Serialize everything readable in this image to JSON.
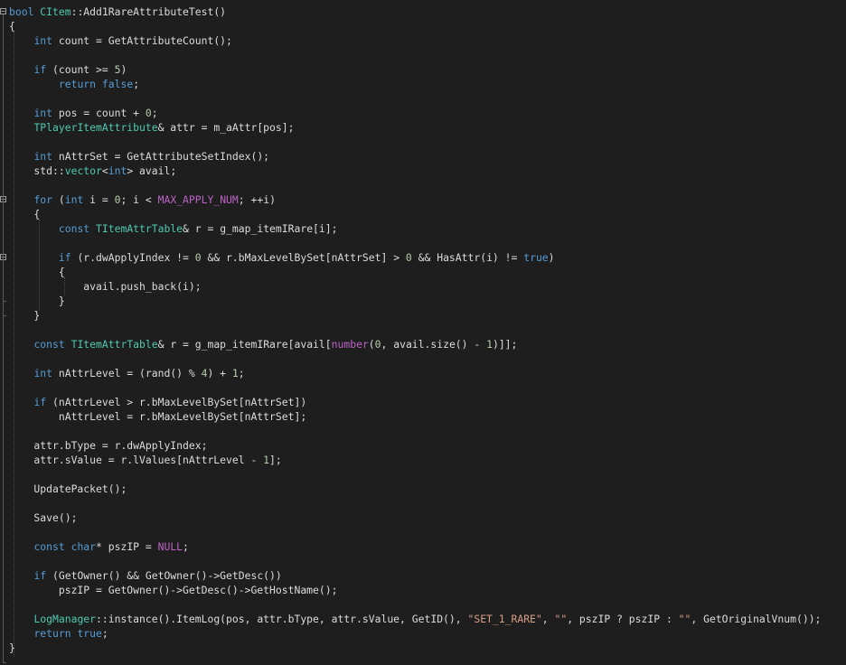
{
  "colors": {
    "background": "#1e1e1e",
    "plain": "#dcdcdc",
    "keyword": "#569cd6",
    "type": "#4ec9b0",
    "number": "#b5cea8",
    "string": "#d69d85",
    "macro": "#bd63c5"
  },
  "editor": {
    "lines": [
      {
        "tokens": [
          [
            "kw",
            "bool"
          ],
          [
            "pl",
            " "
          ],
          [
            "type",
            "CItem"
          ],
          [
            "pl",
            "::Add1RareAttributeTest()"
          ]
        ]
      },
      {
        "tokens": [
          [
            "pl",
            "{"
          ]
        ]
      },
      {
        "tokens": [
          [
            "pl",
            "    "
          ],
          [
            "kw",
            "int"
          ],
          [
            "pl",
            " count = GetAttributeCount();"
          ]
        ]
      },
      {
        "tokens": []
      },
      {
        "tokens": [
          [
            "pl",
            "    "
          ],
          [
            "kw",
            "if"
          ],
          [
            "pl",
            " (count >= "
          ],
          [
            "num",
            "5"
          ],
          [
            "pl",
            ")"
          ]
        ]
      },
      {
        "tokens": [
          [
            "pl",
            "        "
          ],
          [
            "kw",
            "return"
          ],
          [
            "pl",
            " "
          ],
          [
            "kw",
            "false"
          ],
          [
            "pl",
            ";"
          ]
        ]
      },
      {
        "tokens": []
      },
      {
        "tokens": [
          [
            "pl",
            "    "
          ],
          [
            "kw",
            "int"
          ],
          [
            "pl",
            " pos = count + "
          ],
          [
            "num",
            "0"
          ],
          [
            "pl",
            ";"
          ]
        ]
      },
      {
        "tokens": [
          [
            "pl",
            "    "
          ],
          [
            "type",
            "TPlayerItemAttribute"
          ],
          [
            "pl",
            "& attr = m_aAttr[pos];"
          ]
        ]
      },
      {
        "tokens": []
      },
      {
        "tokens": [
          [
            "pl",
            "    "
          ],
          [
            "kw",
            "int"
          ],
          [
            "pl",
            " nAttrSet = GetAttributeSetIndex();"
          ]
        ]
      },
      {
        "tokens": [
          [
            "pl",
            "    std::"
          ],
          [
            "type",
            "vector"
          ],
          [
            "pl",
            "<"
          ],
          [
            "kw",
            "int"
          ],
          [
            "pl",
            "> avail;"
          ]
        ]
      },
      {
        "tokens": []
      },
      {
        "tokens": [
          [
            "pl",
            "    "
          ],
          [
            "kw",
            "for"
          ],
          [
            "pl",
            " ("
          ],
          [
            "kw",
            "int"
          ],
          [
            "pl",
            " i = "
          ],
          [
            "num",
            "0"
          ],
          [
            "pl",
            "; i < "
          ],
          [
            "mac",
            "MAX_APPLY_NUM"
          ],
          [
            "pl",
            "; ++i)"
          ]
        ]
      },
      {
        "tokens": [
          [
            "pl",
            "    {"
          ]
        ]
      },
      {
        "tokens": [
          [
            "pl",
            "        "
          ],
          [
            "kw",
            "const"
          ],
          [
            "pl",
            " "
          ],
          [
            "type",
            "TItemAttrTable"
          ],
          [
            "pl",
            "& r = g_map_itemIRare[i];"
          ]
        ]
      },
      {
        "tokens": []
      },
      {
        "tokens": [
          [
            "pl",
            "        "
          ],
          [
            "kw",
            "if"
          ],
          [
            "pl",
            " (r.dwApplyIndex != "
          ],
          [
            "num",
            "0"
          ],
          [
            "pl",
            " && r.bMaxLevelBySet[nAttrSet] > "
          ],
          [
            "num",
            "0"
          ],
          [
            "pl",
            " && HasAttr(i) != "
          ],
          [
            "kw",
            "true"
          ],
          [
            "pl",
            ")"
          ]
        ]
      },
      {
        "tokens": [
          [
            "pl",
            "        {"
          ]
        ]
      },
      {
        "tokens": [
          [
            "pl",
            "            avail.push_back(i);"
          ]
        ]
      },
      {
        "tokens": [
          [
            "pl",
            "        }"
          ]
        ]
      },
      {
        "tokens": [
          [
            "pl",
            "    }"
          ]
        ]
      },
      {
        "tokens": []
      },
      {
        "tokens": [
          [
            "pl",
            "    "
          ],
          [
            "kw",
            "const"
          ],
          [
            "pl",
            " "
          ],
          [
            "type",
            "TItemAttrTable"
          ],
          [
            "pl",
            "& r = g_map_itemIRare[avail["
          ],
          [
            "mac",
            "number"
          ],
          [
            "pl",
            "("
          ],
          [
            "num",
            "0"
          ],
          [
            "pl",
            ", avail.size() - "
          ],
          [
            "num",
            "1"
          ],
          [
            "pl",
            ")]];"
          ]
        ]
      },
      {
        "tokens": []
      },
      {
        "tokens": [
          [
            "pl",
            "    "
          ],
          [
            "kw",
            "int"
          ],
          [
            "pl",
            " nAttrLevel = (rand() % "
          ],
          [
            "num",
            "4"
          ],
          [
            "pl",
            ") + "
          ],
          [
            "num",
            "1"
          ],
          [
            "pl",
            ";"
          ]
        ]
      },
      {
        "tokens": []
      },
      {
        "tokens": [
          [
            "pl",
            "    "
          ],
          [
            "kw",
            "if"
          ],
          [
            "pl",
            " (nAttrLevel > r.bMaxLevelBySet[nAttrSet])"
          ]
        ]
      },
      {
        "tokens": [
          [
            "pl",
            "        nAttrLevel = r.bMaxLevelBySet[nAttrSet];"
          ]
        ]
      },
      {
        "tokens": []
      },
      {
        "tokens": [
          [
            "pl",
            "    attr.bType = r.dwApplyIndex;"
          ]
        ]
      },
      {
        "tokens": [
          [
            "pl",
            "    attr.sValue = r.lValues[nAttrLevel - "
          ],
          [
            "num",
            "1"
          ],
          [
            "pl",
            "];"
          ]
        ]
      },
      {
        "tokens": []
      },
      {
        "tokens": [
          [
            "pl",
            "    UpdatePacket();"
          ]
        ]
      },
      {
        "tokens": []
      },
      {
        "tokens": [
          [
            "pl",
            "    Save();"
          ]
        ]
      },
      {
        "tokens": []
      },
      {
        "tokens": [
          [
            "pl",
            "    "
          ],
          [
            "kw",
            "const"
          ],
          [
            "pl",
            " "
          ],
          [
            "kw",
            "char"
          ],
          [
            "pl",
            "* pszIP = "
          ],
          [
            "mac",
            "NULL"
          ],
          [
            "pl",
            ";"
          ]
        ]
      },
      {
        "tokens": []
      },
      {
        "tokens": [
          [
            "pl",
            "    "
          ],
          [
            "kw",
            "if"
          ],
          [
            "pl",
            " (GetOwner() && GetOwner()->GetDesc())"
          ]
        ]
      },
      {
        "tokens": [
          [
            "pl",
            "        pszIP = GetOwner()->GetDesc()->GetHostName();"
          ]
        ]
      },
      {
        "tokens": []
      },
      {
        "tokens": [
          [
            "pl",
            "    "
          ],
          [
            "type",
            "LogManager"
          ],
          [
            "pl",
            "::instance().ItemLog(pos, attr.bType, attr.sValue, GetID(), "
          ],
          [
            "str",
            "\"SET_1_RARE\""
          ],
          [
            "pl",
            ", "
          ],
          [
            "str",
            "\"\""
          ],
          [
            "pl",
            ", pszIP ? pszIP : "
          ],
          [
            "str",
            "\"\""
          ],
          [
            "pl",
            ", GetOriginalVnum());"
          ]
        ]
      },
      {
        "tokens": [
          [
            "pl",
            "    "
          ],
          [
            "kw",
            "return"
          ],
          [
            "pl",
            " "
          ],
          [
            "kw",
            "true"
          ],
          [
            "pl",
            ";"
          ]
        ]
      },
      {
        "tokens": [
          [
            "pl",
            "}"
          ]
        ]
      }
    ],
    "fold_markers": [
      {
        "line": 0,
        "icon": "minus-icon"
      },
      {
        "line": 13,
        "icon": "minus-icon"
      },
      {
        "line": 17,
        "icon": "minus-icon"
      }
    ]
  }
}
